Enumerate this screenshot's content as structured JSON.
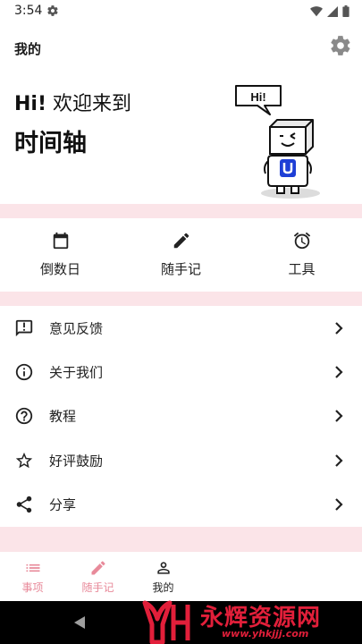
{
  "status_bar": {
    "time": "3:54",
    "icons": [
      "settings-icon",
      "wifi-icon",
      "signal-icon",
      "battery-icon"
    ]
  },
  "header": {
    "title": "我的",
    "settings_icon": "gear-icon"
  },
  "hero": {
    "greeting_hi": "Hi!",
    "greeting_rest": " 欢迎来到",
    "app_name": "时间轴",
    "mascot_bubble": "Hi!"
  },
  "quick_actions": [
    {
      "label": "倒数日",
      "icon": "calendar-icon"
    },
    {
      "label": "随手记",
      "icon": "pencil-icon"
    },
    {
      "label": "工具",
      "icon": "alarm-clock-icon"
    }
  ],
  "menu": [
    {
      "label": "意见反馈",
      "icon": "feedback-icon"
    },
    {
      "label": "关于我们",
      "icon": "info-icon"
    },
    {
      "label": "教程",
      "icon": "help-icon"
    },
    {
      "label": "好评鼓励",
      "icon": "star-icon"
    },
    {
      "label": "分享",
      "icon": "share-icon"
    }
  ],
  "bottom_nav": [
    {
      "label": "事项",
      "icon": "list-icon",
      "active": false
    },
    {
      "label": "随手记",
      "icon": "pencil-icon",
      "active": false
    },
    {
      "label": "我的",
      "icon": "person-icon",
      "active": true
    }
  ],
  "watermark": {
    "text": "永辉资源网",
    "url": "www.yhkjjj.com"
  },
  "colors": {
    "accent_pink": "#e88a9a",
    "band_pink": "#fbe4e8",
    "watermark_red": "#e21f3a"
  }
}
